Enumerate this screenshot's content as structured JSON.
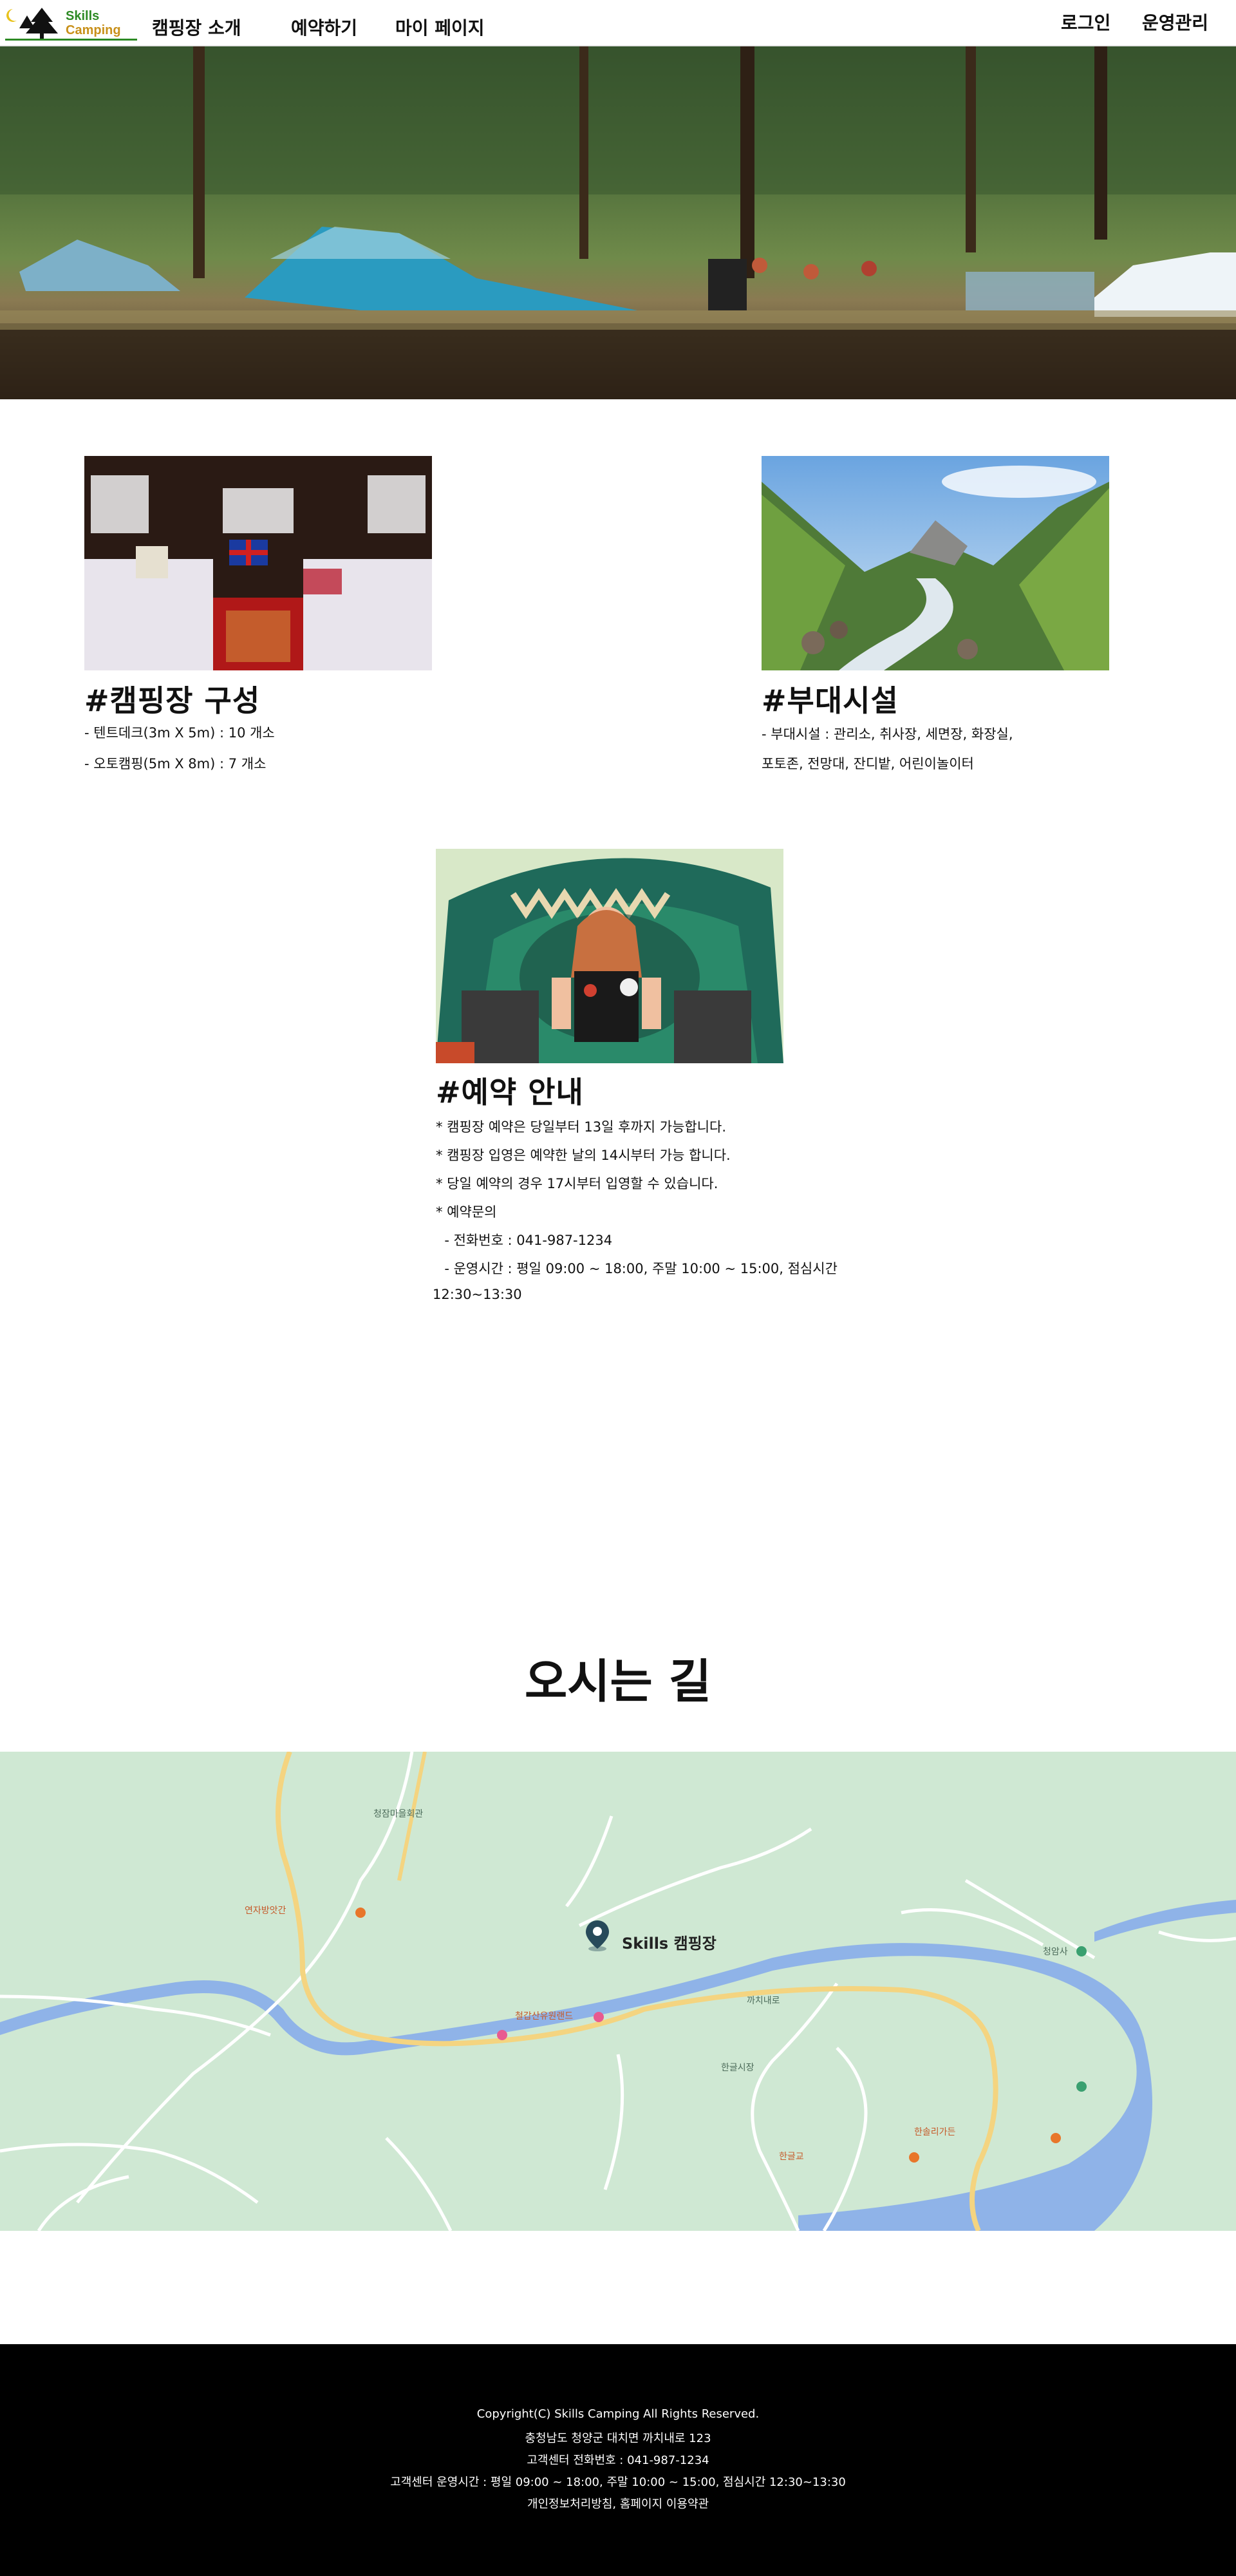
{
  "header": {
    "logo": {
      "line1": "Skills",
      "line2": "Camping"
    },
    "nav": [
      "캠핑장 소개",
      "예약하기",
      "마이 페이지"
    ],
    "login": "로그인",
    "admin": "운영관리"
  },
  "sections": {
    "composition": {
      "title": "#캠핑장 구성",
      "lines": [
        "- 텐트데크(3m X 5m) : 10 개소",
        "- 오토캠핑(5m X 8m) : 7 개소"
      ]
    },
    "facilities": {
      "title": "#부대시설",
      "lines": [
        " - 부대시설 : 관리소, 취사장, 세면장, 화장실,",
        "포토존, 전망대, 잔디밭, 어린이놀이터"
      ]
    },
    "reservation": {
      "title": "#예약 안내",
      "lines": [
        "* 캠핑장 예약은 당일부터 13일 후까지 가능합니다.",
        "* 캠핑장 입영은 예약한 날의 14시부터 가능 합니다.",
        "* 당일 예약의 경우 17시부터 입영할 수 있습니다.",
        "* 예약문의",
        "  - 전화번호 : 041-987-1234",
        "  - 운영시간 : 평일 09:00 ~ 18:00, 주말 10:00 ~ 15:00, 점심시간",
        "12:30~13:30"
      ]
    }
  },
  "directions": {
    "title": "오시는 길",
    "marker_label": "Skills 캠핑장",
    "labels": [
      "청잠마을회관",
      "철갑산유원랜드",
      "까치내로",
      "한글시장",
      "청암사",
      "연자방앗간",
      "한글교",
      "한솔리가든"
    ]
  },
  "footer": {
    "lines": [
      "Copyright(C) Skills Camping All Rights Reserved.",
      "충청남도 청양군 대치면 까치내로 123",
      "고객센터 전화번호 : 041-987-1234",
      "고객센터 운영시간 : 평일 09:00 ~ 18:00, 주말 10:00 ~ 15:00, 점심시간 12:30~13:30",
      "개인정보처리방침, 홈페이지 이용약관"
    ]
  },
  "colors": {
    "logo_green": "#2d8a24",
    "logo_orange": "#c8901a",
    "map_bg": "#cfe8d3",
    "river": "#8fb3e8",
    "footer_bg": "#000000"
  },
  "icons": [
    "tree-icon",
    "moon-icon",
    "map-marker-icon"
  ]
}
